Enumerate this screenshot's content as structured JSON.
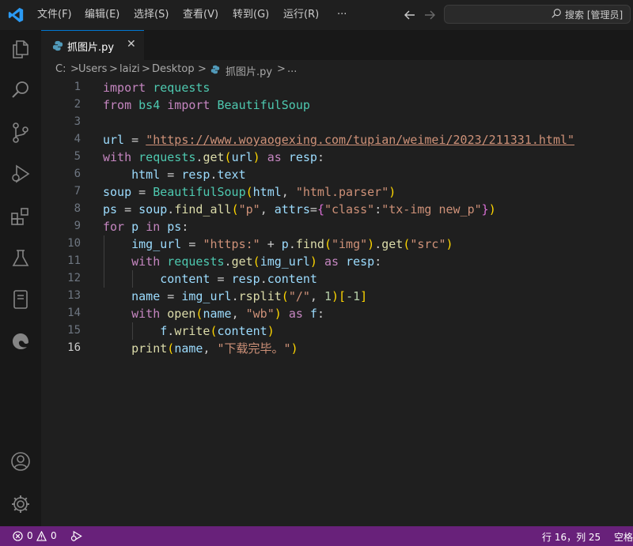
{
  "menu": {
    "items": [
      "文件(F)",
      "编辑(E)",
      "选择(S)",
      "查看(V)",
      "转到(G)",
      "运行(R)",
      "···"
    ]
  },
  "search": {
    "placeholder": "搜索 [管理员]"
  },
  "tab": {
    "filename": "抓图片.py",
    "close_glyph": "✕"
  },
  "breadcrumb": {
    "parts": [
      "C:",
      "Users",
      "laizi",
      "Desktop",
      "抓图片.py",
      "..."
    ],
    "separator": ">"
  },
  "editor": {
    "active_line": 16,
    "lines": [
      [
        [
          "import",
          "kw"
        ],
        [
          " ",
          ""
        ],
        [
          "requests",
          "mod"
        ]
      ],
      [
        [
          "from",
          "kw"
        ],
        [
          " ",
          ""
        ],
        [
          "bs4",
          "mod"
        ],
        [
          " ",
          ""
        ],
        [
          "import",
          "kw"
        ],
        [
          " ",
          ""
        ],
        [
          "BeautifulSoup",
          "cls"
        ]
      ],
      [],
      [
        [
          "url",
          "var"
        ],
        [
          " = ",
          ""
        ],
        [
          "\"https://www.woyaogexing.com/tupian/weimei/2023/211331.html\"",
          "url"
        ]
      ],
      [
        [
          "with",
          "kw"
        ],
        [
          " ",
          ""
        ],
        [
          "requests",
          "mod"
        ],
        [
          ".",
          ""
        ],
        [
          "get",
          "fn"
        ],
        [
          "(",
          "br1"
        ],
        [
          "url",
          "var"
        ],
        [
          ")",
          "br1"
        ],
        [
          " ",
          ""
        ],
        [
          "as",
          "kw"
        ],
        [
          " ",
          ""
        ],
        [
          "resp",
          "var"
        ],
        [
          ":",
          ""
        ]
      ],
      [
        [
          "    ",
          ""
        ],
        [
          "html",
          "var"
        ],
        [
          " = ",
          ""
        ],
        [
          "resp",
          "var"
        ],
        [
          ".",
          ""
        ],
        [
          "text",
          "var"
        ]
      ],
      [
        [
          "soup",
          "var"
        ],
        [
          " = ",
          ""
        ],
        [
          "BeautifulSoup",
          "cls"
        ],
        [
          "(",
          "br1"
        ],
        [
          "html",
          "var"
        ],
        [
          ", ",
          ""
        ],
        [
          "\"html.parser\"",
          "str"
        ],
        [
          ")",
          "br1"
        ]
      ],
      [
        [
          "ps",
          "var"
        ],
        [
          " = ",
          ""
        ],
        [
          "soup",
          "var"
        ],
        [
          ".",
          ""
        ],
        [
          "find_all",
          "fn"
        ],
        [
          "(",
          "br1"
        ],
        [
          "\"p\"",
          "str"
        ],
        [
          ", ",
          ""
        ],
        [
          "attrs",
          "var"
        ],
        [
          "=",
          ""
        ],
        [
          "{",
          "br2"
        ],
        [
          "\"class\"",
          "str"
        ],
        [
          ":",
          ""
        ],
        [
          "\"tx-img new_p\"",
          "str"
        ],
        [
          "}",
          "br2"
        ],
        [
          ")",
          "br1"
        ]
      ],
      [
        [
          "for",
          "kw"
        ],
        [
          " ",
          ""
        ],
        [
          "p",
          "var"
        ],
        [
          " ",
          ""
        ],
        [
          "in",
          "kw"
        ],
        [
          " ",
          ""
        ],
        [
          "ps",
          "var"
        ],
        [
          ":",
          ""
        ]
      ],
      [
        [
          "    ",
          ""
        ],
        [
          "img_url",
          "var"
        ],
        [
          " = ",
          ""
        ],
        [
          "\"https:\"",
          "str"
        ],
        [
          " + ",
          ""
        ],
        [
          "p",
          "var"
        ],
        [
          ".",
          ""
        ],
        [
          "find",
          "fn"
        ],
        [
          "(",
          "br1"
        ],
        [
          "\"img\"",
          "str"
        ],
        [
          ")",
          "br1"
        ],
        [
          ".",
          ""
        ],
        [
          "get",
          "fn"
        ],
        [
          "(",
          "br1"
        ],
        [
          "\"src\"",
          "str"
        ],
        [
          ")",
          "br1"
        ]
      ],
      [
        [
          "    ",
          ""
        ],
        [
          "with",
          "kw"
        ],
        [
          " ",
          ""
        ],
        [
          "requests",
          "mod"
        ],
        [
          ".",
          ""
        ],
        [
          "get",
          "fn"
        ],
        [
          "(",
          "br1"
        ],
        [
          "img_url",
          "var"
        ],
        [
          ")",
          "br1"
        ],
        [
          " ",
          ""
        ],
        [
          "as",
          "kw"
        ],
        [
          " ",
          ""
        ],
        [
          "resp",
          "var"
        ],
        [
          ":",
          ""
        ]
      ],
      [
        [
          "        ",
          ""
        ],
        [
          "content",
          "var"
        ],
        [
          " = ",
          ""
        ],
        [
          "resp",
          "var"
        ],
        [
          ".",
          ""
        ],
        [
          "content",
          "var"
        ]
      ],
      [
        [
          "    ",
          ""
        ],
        [
          "name",
          "var"
        ],
        [
          " = ",
          ""
        ],
        [
          "img_url",
          "var"
        ],
        [
          ".",
          ""
        ],
        [
          "rsplit",
          "fn"
        ],
        [
          "(",
          "br1"
        ],
        [
          "\"/\"",
          "str"
        ],
        [
          ", ",
          ""
        ],
        [
          "1",
          "num"
        ],
        [
          ")",
          "br1"
        ],
        [
          "[",
          "br1"
        ],
        [
          "-1",
          "num"
        ],
        [
          "]",
          "br1"
        ]
      ],
      [
        [
          "    ",
          ""
        ],
        [
          "with",
          "kw"
        ],
        [
          " ",
          ""
        ],
        [
          "open",
          "fn"
        ],
        [
          "(",
          "br1"
        ],
        [
          "name",
          "var"
        ],
        [
          ", ",
          ""
        ],
        [
          "\"wb\"",
          "str"
        ],
        [
          ")",
          "br1"
        ],
        [
          " ",
          ""
        ],
        [
          "as",
          "kw"
        ],
        [
          " ",
          ""
        ],
        [
          "f",
          "var"
        ],
        [
          ":",
          ""
        ]
      ],
      [
        [
          "        ",
          ""
        ],
        [
          "f",
          "var"
        ],
        [
          ".",
          ""
        ],
        [
          "write",
          "fn"
        ],
        [
          "(",
          "br1"
        ],
        [
          "content",
          "var"
        ],
        [
          ")",
          "br1"
        ]
      ],
      [
        [
          "    ",
          ""
        ],
        [
          "print",
          "fn"
        ],
        [
          "(",
          "br1"
        ],
        [
          "name",
          "var"
        ],
        [
          ", ",
          ""
        ],
        [
          "\"下载完毕。\"",
          "str"
        ],
        [
          ")",
          "br1"
        ]
      ]
    ]
  },
  "statusbar": {
    "errors": "0",
    "warnings": "0",
    "position": "行 16，列 25",
    "indent": "空格"
  },
  "colors": {
    "kw": "#c586c0",
    "mod": "#4ec9b0",
    "cls": "#4ec9b0",
    "var": "#9cdcfe",
    "fn": "#dcdcaa",
    "str": "#ce9178",
    "url": "#ce9178",
    "num": "#b5cea8",
    "br1": "#ffd700",
    "br2": "#da70d6",
    "accent": "#0078d4",
    "status_bg": "#68217a"
  }
}
